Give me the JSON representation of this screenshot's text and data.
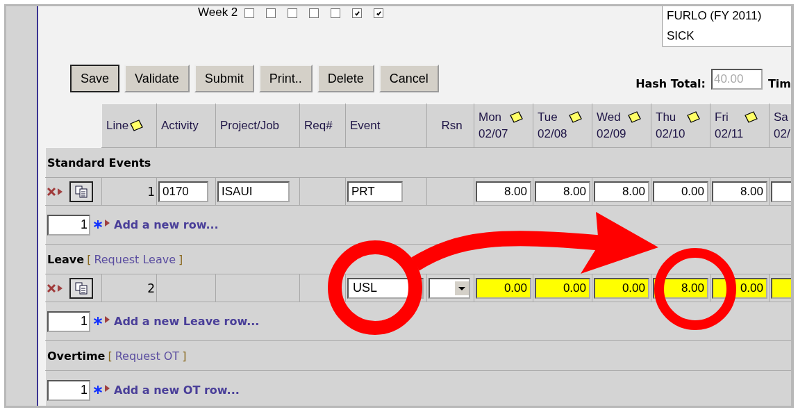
{
  "week": {
    "label": "Week 2",
    "checks": [
      {
        "checked": false
      },
      {
        "checked": false
      },
      {
        "checked": false
      },
      {
        "checked": false
      },
      {
        "checked": false
      },
      {
        "checked": true
      },
      {
        "checked": true
      }
    ]
  },
  "list_box": {
    "items": [
      "FURLO (FY 2011)",
      "SICK"
    ]
  },
  "buttons": [
    {
      "label": "Save",
      "selected": true
    },
    {
      "label": "Validate",
      "selected": false
    },
    {
      "label": "Submit",
      "selected": false
    },
    {
      "label": "Print..",
      "selected": false
    },
    {
      "label": "Delete",
      "selected": false
    },
    {
      "label": "Cancel",
      "selected": false
    }
  ],
  "hash_total": {
    "label": "Hash Total:",
    "value": "40.00",
    "disabled": true
  },
  "cut_label": "Tim",
  "table": {
    "columns": [
      {
        "label": "Line",
        "note": true
      },
      {
        "label": "Activity"
      },
      {
        "label": "Project/Job"
      },
      {
        "label": "Req#"
      },
      {
        "label": "Event"
      },
      {
        "label": "Rsn"
      },
      {
        "label": "Mon",
        "date": "02/07",
        "note": true
      },
      {
        "label": "Tue",
        "date": "02/08",
        "note": true
      },
      {
        "label": "Wed",
        "date": "02/09",
        "note": true
      },
      {
        "label": "Thu",
        "date": "02/10",
        "note": true
      },
      {
        "label": "Fri",
        "date": "02/11",
        "note": true
      },
      {
        "label": "Sa",
        "date": "02/"
      }
    ],
    "sections": [
      {
        "title": "Standard Events",
        "rows": [
          {
            "kind": "standard",
            "line": "1",
            "activity": "0170",
            "project": "ISAUI",
            "event": "PRT",
            "highlighted": false,
            "hours": [
              "8.00",
              "8.00",
              "8.00",
              "0.00",
              "8.00"
            ]
          }
        ],
        "add": {
          "count": "1",
          "link": "Add a new row..."
        }
      },
      {
        "title": "Leave",
        "bracket_open": "[",
        "link": "Request Leave",
        "bracket_close": "]",
        "rows": [
          {
            "kind": "leave",
            "line": "2",
            "event": "USL",
            "highlighted": true,
            "hours": [
              "0.00",
              "0.00",
              "0.00",
              "8.00",
              "0.00"
            ]
          }
        ],
        "add": {
          "count": "1",
          "link": "Add a new Leave row..."
        }
      },
      {
        "title": "Overtime",
        "bracket_open": "[",
        "link": "Request OT",
        "bracket_close": "]",
        "add": {
          "count": "1",
          "link": "Add a new OT row..."
        }
      }
    ]
  }
}
